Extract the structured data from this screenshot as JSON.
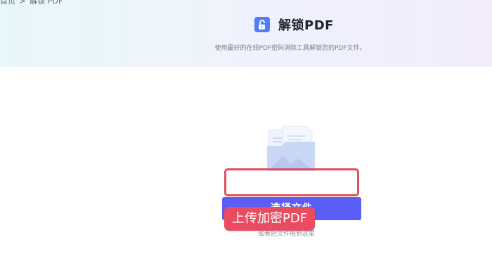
{
  "breadcrumb": {
    "home": "首页",
    "separator": ">",
    "current": "解锁 PDF"
  },
  "header": {
    "tool_icon": "unlock-icon",
    "title": "解锁PDF",
    "subtitle": "使用最好的在线PDF密码消除工具解锁您的PDF文件。"
  },
  "upload": {
    "illustration": "folder-document-illustration",
    "select_button_label": "选择文件",
    "drop_hint": "或者把文件拖到这里"
  },
  "annotation": {
    "label": "上传加密PDF",
    "highlight_color": "#e0505e"
  },
  "colors": {
    "primary": "#5b5ef6",
    "icon_blue": "#4f7ef7",
    "annotation_red": "#ea4c5f"
  }
}
